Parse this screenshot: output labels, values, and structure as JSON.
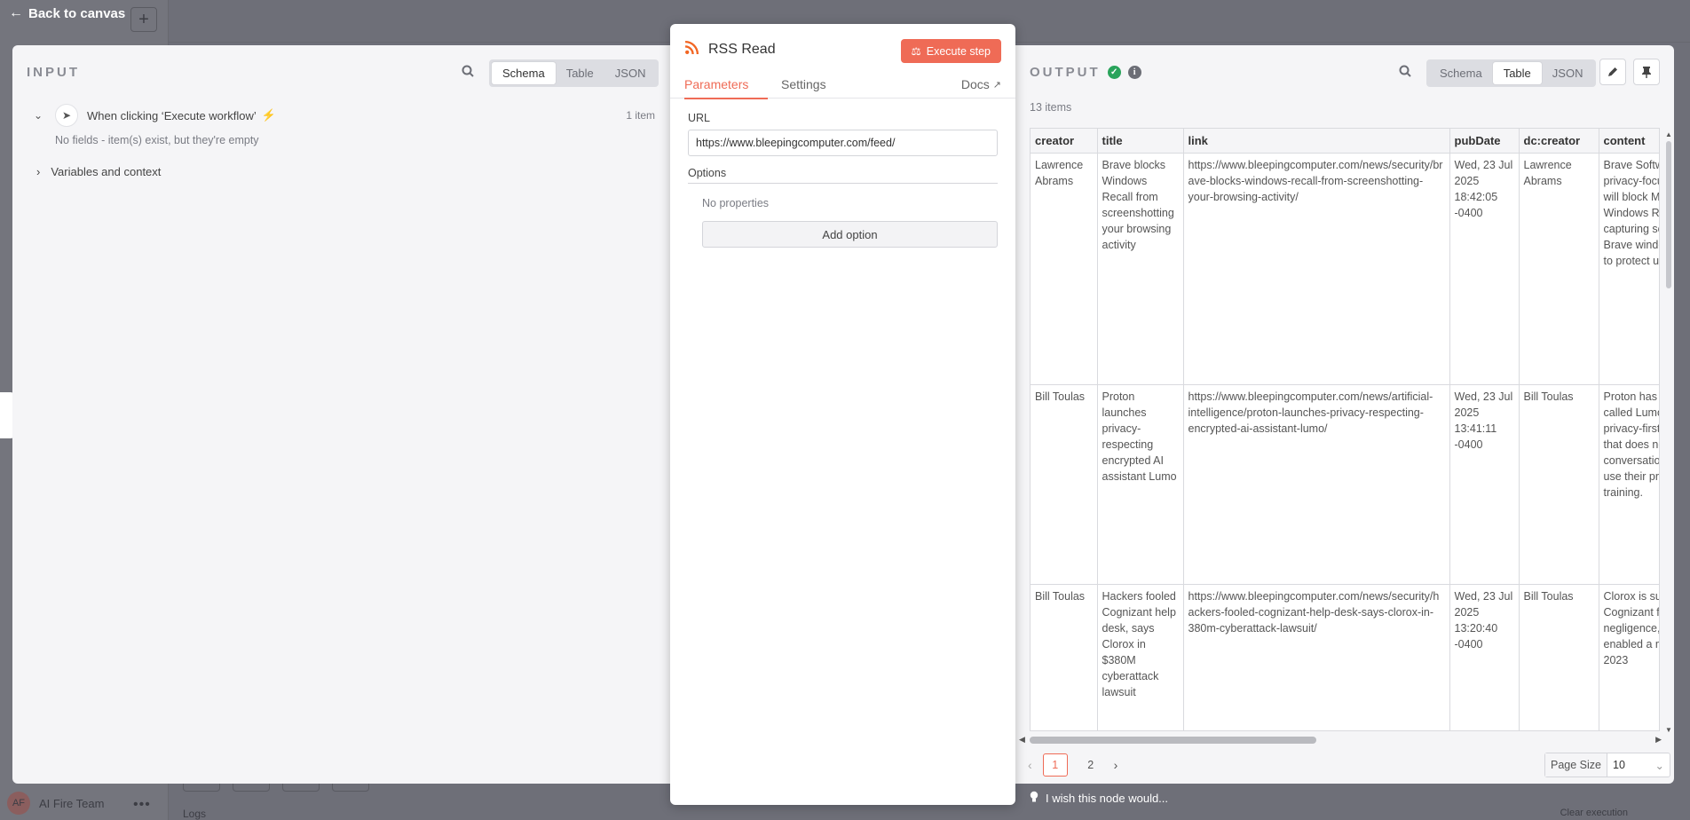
{
  "canvas": {
    "back_label": "Back to canvas",
    "team_initials": "AF",
    "team_name": "AI Fire Team",
    "logs_label": "Logs",
    "clear_label": "Clear execution"
  },
  "input": {
    "title": "INPUT",
    "views": [
      "Schema",
      "Table",
      "JSON"
    ],
    "active_view": "Schema",
    "trigger_name": "When clicking ‘Execute workflow’",
    "trigger_items": "1 item",
    "empty_note": "No fields - item(s) exist, but they're empty",
    "variables_label": "Variables and context"
  },
  "node": {
    "title": "RSS Read",
    "execute_label": "Execute step",
    "tabs": [
      "Parameters",
      "Settings"
    ],
    "active_tab": "Parameters",
    "docs_label": "Docs",
    "url_label": "URL",
    "url_value": "https://www.bleepingcomputer.com/feed/",
    "options_label": "Options",
    "no_properties": "No properties",
    "add_option_label": "Add option"
  },
  "output": {
    "title": "OUTPUT",
    "views": [
      "Schema",
      "Table",
      "JSON"
    ],
    "active_view": "Table",
    "item_total": "13 items",
    "columns": [
      "creator",
      "title",
      "link",
      "pubDate",
      "dc:creator",
      "content"
    ],
    "rows": [
      [
        "Lawrence Abrams",
        "Brave blocks Windows Recall from screenshotting your browsing activity",
        "https://www.bleepingcomputer.com/news/security/brave-blocks-windows-recall-from-screenshotting-your-browsing-activity/",
        "Wed, 23 Jul 2025 18:42:05 -0400",
        "Lawrence Abrams",
        "Brave Software says its privacy-focused browser will block Microsoft's Windows Recall from capturing screenshots. Brave windows by default to protect user privacy. [...]"
      ],
      [
        "Bill Toulas",
        "Proton launches privacy-respecting encrypted AI assistant Lumo",
        "https://www.bleepingcomputer.com/news/artificial-intelligence/proton-launches-privacy-respecting-encrypted-ai-assistant-lumo/",
        "Wed, 23 Jul 2025 13:41:11 -0400",
        "Bill Toulas",
        "Proton has launched a tool called Lumo, offering a privacy-first AI assistant that does not log user conversations and doesn't use their prompts for training."
      ],
      [
        "Bill Toulas",
        "Hackers fooled Cognizant help desk, says Clorox in $380M cyberattack lawsuit",
        "https://www.bleepingcomputer.com/news/security/hackers-fooled-cognizant-help-desk-says-clorox-in-380m-cyberattack-lawsuit/",
        "Wed, 23 Jul 2025 13:20:40 -0400",
        "Bill Toulas",
        "Clorox is suing IT giant Cognizant for gross negligence, alleging it enabled a massive August 2023"
      ]
    ],
    "pages": [
      "1",
      "2"
    ],
    "current_page": "1",
    "page_size_label": "Page Size",
    "page_size_value": "10"
  },
  "footer": {
    "wish_label": "I wish this node would..."
  },
  "colors": {
    "accent": "#ef6b56",
    "success": "#29a35b",
    "rss": "#f26522"
  },
  "icons": [
    "arrow-left-icon",
    "search-icon",
    "cursor-icon",
    "bolt-icon",
    "chevron-down-icon",
    "chevron-right-icon",
    "rss-icon",
    "flask-icon",
    "external-link-icon",
    "check-circle-icon",
    "info-icon",
    "pencil-icon",
    "pin-icon",
    "lightbulb-icon"
  ]
}
